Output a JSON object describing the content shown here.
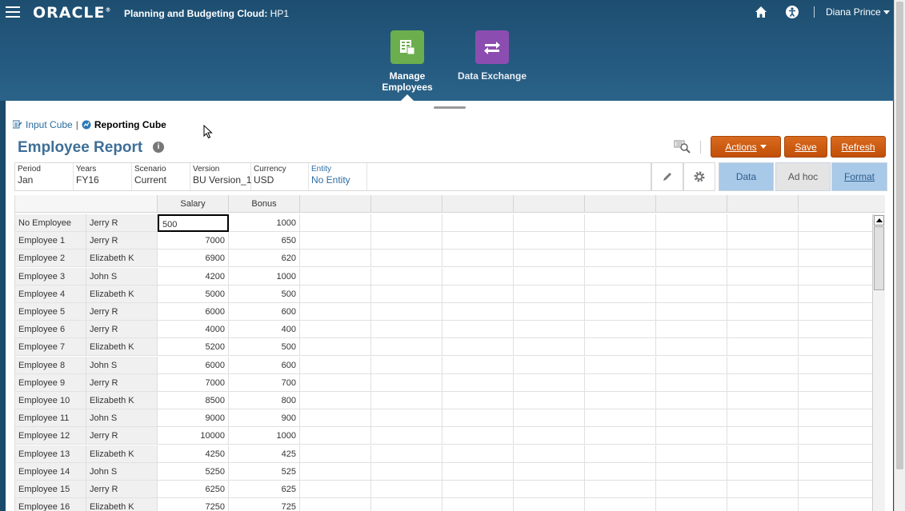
{
  "header": {
    "logo": "ORACLE",
    "app_name": "Planning and Budgeting Cloud:",
    "instance": "HP1",
    "user": "Diana Prince"
  },
  "nav": {
    "manage_line1": "Manage",
    "manage_line2": "Employees",
    "data_exchange": "Data Exchange"
  },
  "breadcrumb": {
    "input_cube": "Input Cube",
    "separator": "|",
    "reporting_cube": "Reporting Cube"
  },
  "page": {
    "title": "Employee Report",
    "info_glyph": "i"
  },
  "toolbar": {
    "actions_label": "Actions",
    "save_label": "Save",
    "refresh_label": "Refresh"
  },
  "pov": [
    {
      "label": "Period",
      "value": "Jan"
    },
    {
      "label": "Years",
      "value": "FY16"
    },
    {
      "label": "Scenario",
      "value": "Current"
    },
    {
      "label": "Version",
      "value": "BU Version_1"
    },
    {
      "label": "Currency",
      "value": "USD"
    },
    {
      "label": "Entity",
      "value": "No Entity"
    }
  ],
  "modes": {
    "data": "Data",
    "adhoc": "Ad hoc",
    "format": "Format"
  },
  "grid": {
    "columns": [
      "Salary",
      "Bonus"
    ],
    "editing_value": "500",
    "rows": [
      {
        "employee": "No Employee",
        "manager": "Jerry R",
        "salary": "500",
        "bonus": "1000"
      },
      {
        "employee": "Employee 1",
        "manager": "Jerry R",
        "salary": "7000",
        "bonus": "650"
      },
      {
        "employee": "Employee 2",
        "manager": "Elizabeth K",
        "salary": "6900",
        "bonus": "620"
      },
      {
        "employee": "Employee 3",
        "manager": "John S",
        "salary": "4200",
        "bonus": "1000"
      },
      {
        "employee": "Employee 4",
        "manager": "Elizabeth K",
        "salary": "5000",
        "bonus": "500"
      },
      {
        "employee": "Employee 5",
        "manager": "Jerry R",
        "salary": "6000",
        "bonus": "600"
      },
      {
        "employee": "Employee 6",
        "manager": "Jerry R",
        "salary": "4000",
        "bonus": "400"
      },
      {
        "employee": "Employee 7",
        "manager": "Elizabeth K",
        "salary": "5200",
        "bonus": "500"
      },
      {
        "employee": "Employee 8",
        "manager": "John S",
        "salary": "6000",
        "bonus": "600"
      },
      {
        "employee": "Employee 9",
        "manager": "Jerry R",
        "salary": "7000",
        "bonus": "700"
      },
      {
        "employee": "Employee 10",
        "manager": "Elizabeth K",
        "salary": "8500",
        "bonus": "800"
      },
      {
        "employee": "Employee 11",
        "manager": "John S",
        "salary": "9000",
        "bonus": "900"
      },
      {
        "employee": "Employee 12",
        "manager": "Jerry R",
        "salary": "10000",
        "bonus": "1000"
      },
      {
        "employee": "Employee 13",
        "manager": "Elizabeth K",
        "salary": "4250",
        "bonus": "425"
      },
      {
        "employee": "Employee 14",
        "manager": "John S",
        "salary": "5250",
        "bonus": "525"
      },
      {
        "employee": "Employee 15",
        "manager": "Jerry R",
        "salary": "6250",
        "bonus": "625"
      },
      {
        "employee": "Employee 16",
        "manager": "Elizabeth K",
        "salary": "7250",
        "bonus": "725"
      }
    ]
  },
  "colors": {
    "header_bg": "#255a80",
    "accent_orange": "#c95a10",
    "manage_tile": "#6cae4e",
    "data_exchange_tile": "#8c4db0",
    "title_blue": "#3e6f98"
  }
}
